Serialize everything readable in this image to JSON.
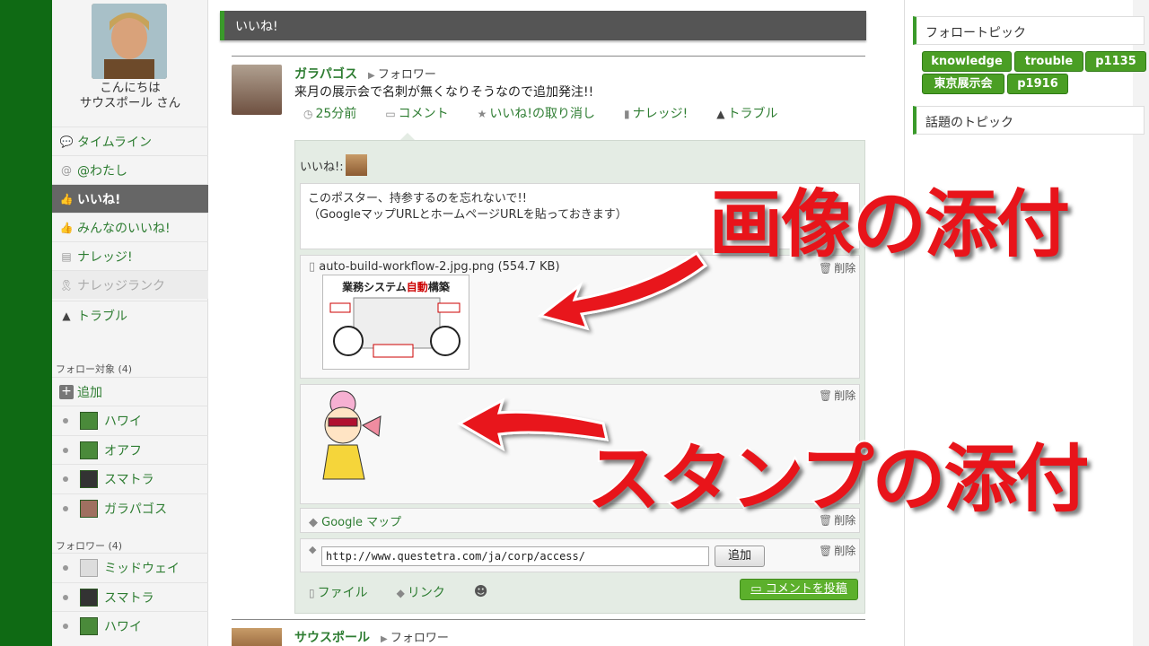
{
  "sidebar": {
    "greeting_line1": "こんにちは",
    "greeting_line2": "サウスポール さん",
    "nav": [
      {
        "label": "タイムライン",
        "icon": "chat-icon"
      },
      {
        "label": "@わたし",
        "icon": "at-icon"
      },
      {
        "label": "いいね!",
        "icon": "thumbs-up-icon"
      },
      {
        "label": "みんなのいいね!",
        "icon": "thumbs-up-icon"
      },
      {
        "label": "ナレッジ!",
        "icon": "book-icon"
      },
      {
        "label": "ナレッジランク",
        "icon": "ribbon-icon"
      },
      {
        "label": "トラブル",
        "icon": "warning-icon"
      }
    ],
    "following_header": "フォロー対象 (4)",
    "add_label": "追加",
    "following": [
      "ハワイ",
      "オアフ",
      "スマトラ",
      "ガラパゴス"
    ],
    "followers_header": "フォロワー (4)",
    "followers": [
      "ミッドウェイ",
      "スマトラ",
      "ハワイ"
    ]
  },
  "main": {
    "title": "いいね!",
    "post": {
      "author": "ガラパゴス",
      "relation": "フォロワー",
      "body": "来月の展示会で名刺が無くなりそうなので追加発注!!",
      "actions": [
        {
          "label": "25分前",
          "icon": "clock-icon"
        },
        {
          "label": "コメント",
          "icon": "comment-icon"
        },
        {
          "label": "いいね!の取り消し",
          "icon": "star-icon"
        },
        {
          "label": "ナレッジ!",
          "icon": "book-icon"
        },
        {
          "label": "トラブル",
          "icon": "warning-icon"
        }
      ]
    },
    "comment": {
      "liked_by_label": "いいね!:",
      "text_line1": "このポスター、持参するのを忘れないで!!",
      "text_line2": "（GoogleマップURLとホームページURLを貼っておきます）",
      "file_name": "auto-build-workflow-2.jpg.png (554.7 KB)",
      "thumb_title_a": "業務システム",
      "thumb_title_b": "自動",
      "thumb_title_c": "構築",
      "delete_label": "削除",
      "link_label": "Google マップ",
      "url_value": "http://www.questetra.com/ja/corp/access/",
      "add_button": "追加",
      "footer_file": "ファイル",
      "footer_link": "リンク",
      "post_button": "コメントを投稿"
    },
    "next_post": {
      "author": "サウスポール",
      "relation": "フォロワー"
    }
  },
  "right": {
    "follow_topics_header": "フォロートピック",
    "tags": [
      "knowledge",
      "trouble",
      "p1135",
      "東京展示会",
      "p1916"
    ],
    "hot_topics_header": "話題のトピック"
  },
  "annotations": {
    "image_attach": "画像の添付",
    "stamp_attach": "スタンプの添付"
  }
}
